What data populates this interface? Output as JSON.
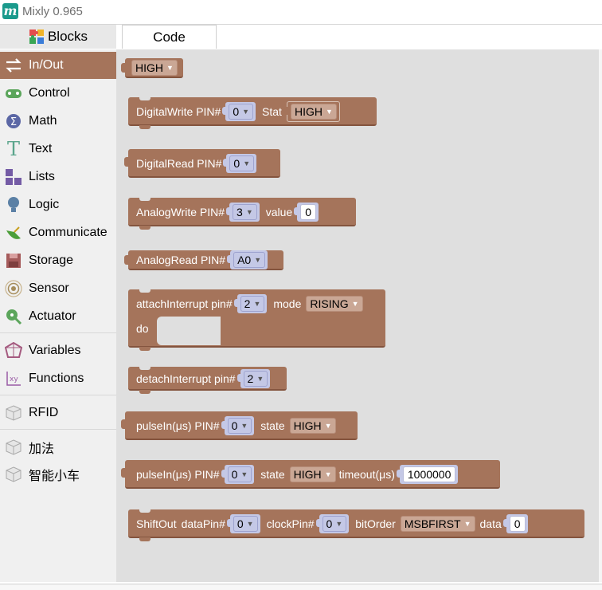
{
  "window": {
    "title": "Mixly 0.965"
  },
  "tabs": {
    "blocks": "Blocks",
    "code": "Code"
  },
  "categories": [
    {
      "label": "In/Out",
      "icon": "arrows-icon",
      "color": "#a5745b"
    },
    {
      "label": "Control",
      "icon": "gamepad-icon",
      "color": "#5ba55b"
    },
    {
      "label": "Math",
      "icon": "sigma-icon",
      "color": "#5b67a5"
    },
    {
      "label": "Text",
      "icon": "text-icon",
      "color": "#5ba58c"
    },
    {
      "label": "Lists",
      "icon": "lists-icon",
      "color": "#745ba5"
    },
    {
      "label": "Logic",
      "icon": "bulb-icon",
      "color": "#5b80a5"
    },
    {
      "label": "Communicate",
      "icon": "satellite-icon",
      "color": "#4c9e3a"
    },
    {
      "label": "Storage",
      "icon": "storage-icon",
      "color": "#a55b5b"
    },
    {
      "label": "Sensor",
      "icon": "sensor-icon",
      "color": "#a58c5b"
    },
    {
      "label": "Actuator",
      "icon": "actuator-icon",
      "color": "#5ba55b"
    },
    {
      "label": "Variables",
      "icon": "variables-icon",
      "color": "#a55b80"
    },
    {
      "label": "Functions",
      "icon": "functions-icon",
      "color": "#995ba5"
    },
    {
      "label": "RFID",
      "icon": "cube-icon",
      "color": "#999999"
    },
    {
      "label": "加法",
      "icon": "cube-icon",
      "color": "#999999"
    },
    {
      "label": "智能小车",
      "icon": "cube-icon",
      "color": "#999999"
    }
  ],
  "blocks": {
    "high_value": {
      "value": "HIGH"
    },
    "digital_write": {
      "label": "DigitalWrite PIN#",
      "pin": "0",
      "stat_label": "Stat",
      "stat": "HIGH"
    },
    "digital_read": {
      "label": "DigitalRead PIN#",
      "pin": "0"
    },
    "analog_write": {
      "label": "AnalogWrite PIN#",
      "pin": "3",
      "value_label": "value",
      "value": "0"
    },
    "analog_read": {
      "label": "AnalogRead PIN#",
      "pin": "A0"
    },
    "attach_interrupt": {
      "label": "attachInterrupt pin#",
      "pin": "2",
      "mode_label": "mode",
      "mode": "RISING",
      "do_label": "do"
    },
    "detach_interrupt": {
      "label": "detachInterrupt pin#",
      "pin": "2"
    },
    "pulse_in": {
      "label": "pulseIn(μs) PIN#",
      "pin": "0",
      "state_label": "state",
      "state": "HIGH"
    },
    "pulse_in_timeout": {
      "label": "pulseIn(μs) PIN#",
      "pin": "0",
      "state_label": "state",
      "state": "HIGH",
      "timeout_label": "timeout(μs)",
      "timeout": "1000000"
    },
    "shift_out": {
      "label": "ShiftOut",
      "data_pin_label": "dataPin#",
      "data_pin": "0",
      "clock_pin_label": "clockPin#",
      "clock_pin": "0",
      "bit_order_label": "bitOrder",
      "bit_order": "MSBFIRST",
      "data_label": "data",
      "data": "0"
    }
  }
}
